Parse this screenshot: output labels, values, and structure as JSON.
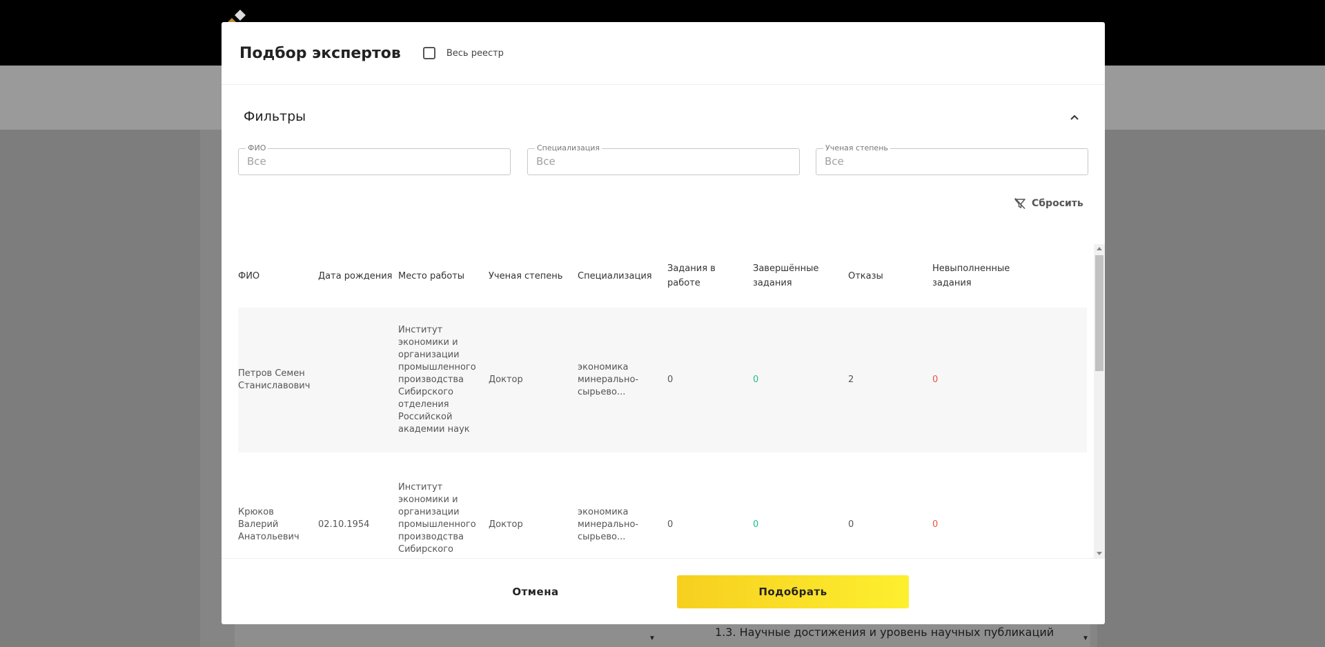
{
  "background": {
    "section_text": "1.3. Научные достижения и уровень научных публикаций"
  },
  "modal": {
    "title": "Подбор экспертов",
    "whole_registry_label": "Весь реестр",
    "filters": {
      "title": "Фильтры",
      "fio": {
        "label": "ФИО",
        "placeholder": "Все"
      },
      "specialization": {
        "label": "Специализация",
        "placeholder": "Все"
      },
      "degree": {
        "label": "Ученая степень",
        "placeholder": "Все"
      },
      "reset_label": "Сбросить"
    },
    "table": {
      "columns": {
        "fio": "ФИО",
        "birth_date": "Дата рождения",
        "workplace": "Место работы",
        "degree": "Ученая степень",
        "specialization": "Специализация",
        "in_progress": "Задания в работе",
        "completed": "Завершённые задания",
        "refusals": "Отказы",
        "unfulfilled": "Невыполненные задания"
      },
      "rows": [
        {
          "fio": "Петров Семен Станиславович",
          "birth_date": "",
          "workplace": "Институт экономики и организации промышленного производства Сибирского отделения Российской академии наук",
          "degree": "Доктор",
          "specialization": "экономика минерально-сырьево...",
          "in_progress": "0",
          "completed": "0",
          "refusals": "2",
          "unfulfilled": "0"
        },
        {
          "fio": "Крюков Валерий Анатольевич",
          "birth_date": "02.10.1954",
          "workplace": "Институт экономики и организации промышленного производства Сибирского отделения",
          "degree": "Доктор",
          "specialization": "экономика минерально-сырьево...",
          "in_progress": "0",
          "completed": "0",
          "refusals": "0",
          "unfulfilled": "0"
        }
      ]
    },
    "footer": {
      "cancel_label": "Отмена",
      "submit_label": "Подобрать"
    },
    "colors": {
      "accent": "#f7cf1f",
      "completed": "#1fbf8f",
      "unfulfilled": "#e7553b"
    }
  }
}
